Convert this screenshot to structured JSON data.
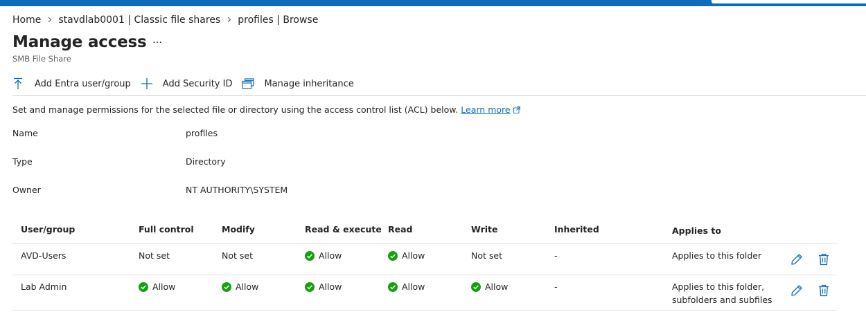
{
  "breadcrumb": [
    {
      "label": "Home"
    },
    {
      "label": "stavdlab0001 | Classic file shares"
    },
    {
      "label": "profiles | Browse"
    }
  ],
  "page": {
    "title": "Manage access",
    "more": "…",
    "subtitle": "SMB File Share"
  },
  "toolbar": {
    "add_entra": "Add Entra user/group",
    "add_sid": "Add Security ID",
    "manage_inheritance": "Manage inheritance"
  },
  "description": {
    "text": "Set and manage permissions for the selected file or directory using the access control list (ACL) below.",
    "link": "Learn more"
  },
  "properties": {
    "name_label": "Name",
    "name_value": "profiles",
    "type_label": "Type",
    "type_value": "Directory",
    "owner_label": "Owner",
    "owner_value": "NT AUTHORITY\\SYSTEM"
  },
  "acl": {
    "columns": [
      "User/group",
      "Full control",
      "Modify",
      "Read & execute",
      "Read",
      "Write",
      "Inherited",
      "Applies to"
    ],
    "rows": [
      {
        "user": "AVD-Users",
        "full": "Not set",
        "modify": "Not set",
        "read_execute": "Allow",
        "read": "Allow",
        "write": "Not set",
        "inherited": "-",
        "applies": "Applies to this folder"
      },
      {
        "user": "Lab Admin",
        "full": "Allow",
        "modify": "Allow",
        "read_execute": "Allow",
        "read": "Allow",
        "write": "Allow",
        "inherited": "-",
        "applies": "Applies to this folder, subfolders and subfiles"
      }
    ]
  },
  "colors": {
    "accent": "#0f6cbd",
    "allow_green": "#13a10e",
    "text": "#242424"
  },
  "icons": {
    "add_entra": "upload-arrow-icon",
    "add_sid": "plus-icon",
    "manage_inheritance": "window-stack-icon",
    "allow": "green-check-circle-icon",
    "edit": "pencil-icon",
    "delete": "trash-icon",
    "external": "external-link-icon"
  }
}
